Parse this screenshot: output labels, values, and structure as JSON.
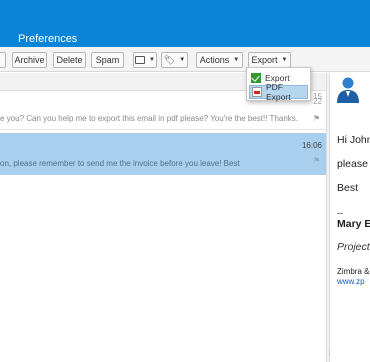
{
  "header": {
    "tab": "Preferences",
    "bg_color": "#0a84d6"
  },
  "toolbar": {
    "archive": "Archive",
    "delete": "Delete",
    "spam": "Spam",
    "actions": "Actions",
    "export": "Export"
  },
  "export_menu": {
    "items": [
      {
        "label": "Export",
        "icon": "green-check-icon",
        "selected": false
      },
      {
        "label": "PDF Export",
        "icon": "pdf-file-icon",
        "selected": true
      }
    ]
  },
  "messages": [
    {
      "snippet": "e you? Can you help me to export this email in pdf please? You're the best!! Thanks.",
      "time": "22",
      "time_top": "15",
      "selected": false
    },
    {
      "snippet": "on, please remember to send me the invoice before you leave! Best",
      "time": "16:06",
      "selected": true
    }
  ],
  "reading_pane": {
    "greeting": "Hi John",
    "line1": "please",
    "closing": "Best",
    "separator": "--",
    "name": "Mary E",
    "title": "Project",
    "org": "Zimbra &",
    "link": "www.zp"
  },
  "colors": {
    "selected_row": "#a8cfee",
    "menu_highlight": "#b6d6ee"
  }
}
